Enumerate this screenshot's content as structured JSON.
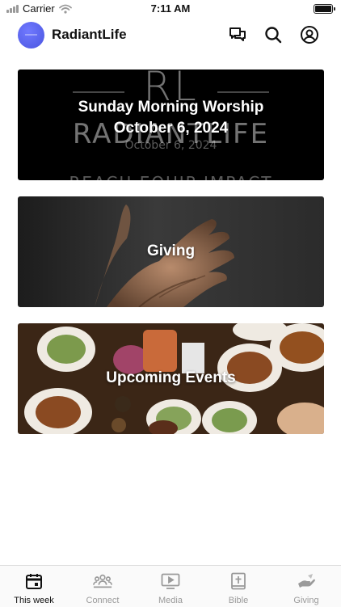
{
  "status_bar": {
    "carrier": "Carrier",
    "time": "7:11 AM"
  },
  "header": {
    "app_name": "RadiantLife",
    "icons": [
      "chat-icon",
      "search-icon",
      "account-icon"
    ]
  },
  "cards": {
    "worship": {
      "title": "Sunday Morning Worship",
      "subtitle": "October 6, 2024",
      "date_watermark": "October 6, 2024",
      "logo_letters": "RL",
      "logo_text": "RADIANTLIFE",
      "tagline": "REACH EQUIP IMPACT"
    },
    "giving": {
      "title": "Giving"
    },
    "events": {
      "title": "Upcoming Events"
    }
  },
  "tabs": [
    {
      "label": "This week",
      "icon": "calendar-icon",
      "active": true
    },
    {
      "label": "Connect",
      "icon": "people-icon",
      "active": false
    },
    {
      "label": "Media",
      "icon": "play-icon",
      "active": false
    },
    {
      "label": "Bible",
      "icon": "bible-icon",
      "active": false
    },
    {
      "label": "Giving",
      "icon": "hand-icon",
      "active": false
    }
  ],
  "colors": {
    "accent": "#5a63f0",
    "active_tab": "#111111",
    "inactive_tab": "#9a9a9a"
  }
}
